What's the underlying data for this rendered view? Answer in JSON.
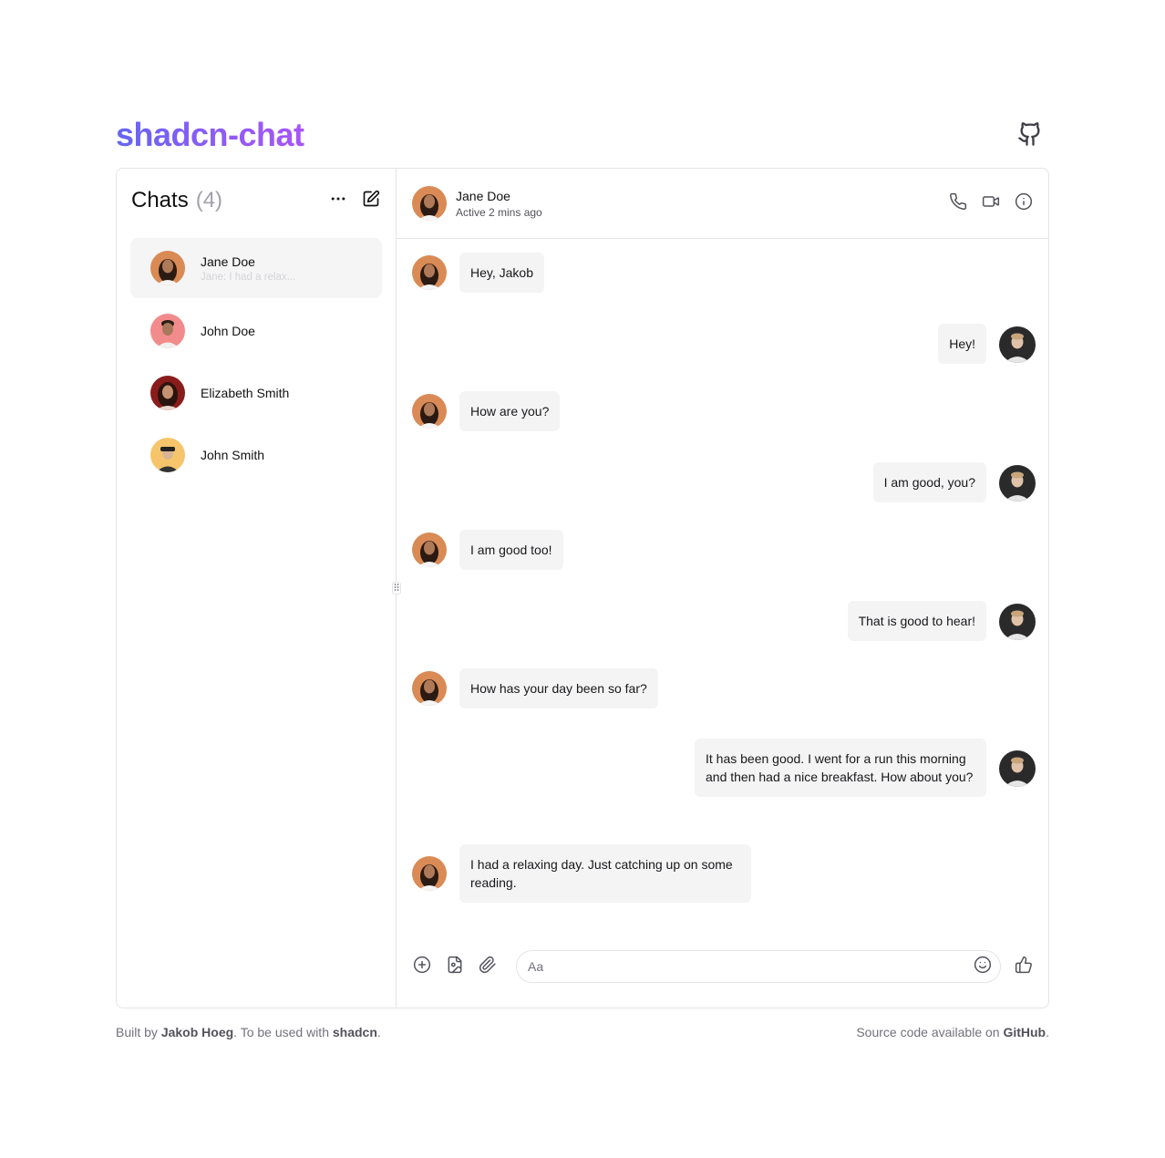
{
  "brand": {
    "title": "shadcn-chat"
  },
  "sidebar": {
    "title": "Chats",
    "count": "(4)",
    "chats": [
      {
        "name": "Jane Doe",
        "preview": "Jane: I had a relax...",
        "avatar": "avatar-jane"
      },
      {
        "name": "John Doe",
        "avatar": "avatar-john-doe"
      },
      {
        "name": "Elizabeth Smith",
        "avatar": "avatar-elizabeth"
      },
      {
        "name": "John Smith",
        "avatar": "avatar-john-smith"
      }
    ]
  },
  "header": {
    "name": "Jane Doe",
    "status": "Active 2 mins ago"
  },
  "messages": [
    {
      "from": "in",
      "text": "Hey, Jakob"
    },
    {
      "from": "out",
      "text": "Hey!"
    },
    {
      "from": "in",
      "text": "How are you?"
    },
    {
      "from": "out",
      "text": "I am good, you?"
    },
    {
      "from": "in",
      "text": "I am good too!"
    },
    {
      "from": "out",
      "text": "That is good to hear!"
    },
    {
      "from": "in",
      "text": "How has your day been so far?"
    },
    {
      "from": "out",
      "text": "It has been good. I went for a run this morning and then had a nice breakfast. How about you?"
    },
    {
      "from": "in",
      "text": "I had a relaxing day. Just catching up on some reading."
    }
  ],
  "composer": {
    "placeholder": "Aa"
  },
  "footer": {
    "left_prefix": "Built by ",
    "left_author": "Jakob Hoeg",
    "left_mid": ". To be used with ",
    "left_link": "shadcn",
    "left_suffix": ".",
    "right_prefix": "Source code available on ",
    "right_link": "GitHub",
    "right_suffix": "."
  },
  "colors": {
    "brand_start": "#6366f1",
    "brand_end": "#a855f7",
    "bubble": "#f4f4f5",
    "border": "#e4e4e7"
  },
  "icons": [
    "github-icon",
    "more-icon",
    "edit-icon",
    "phone-icon",
    "video-icon",
    "info-icon",
    "plus-circle-icon",
    "image-icon",
    "paperclip-icon",
    "smile-icon",
    "thumbs-up-icon",
    "grip-icon"
  ]
}
